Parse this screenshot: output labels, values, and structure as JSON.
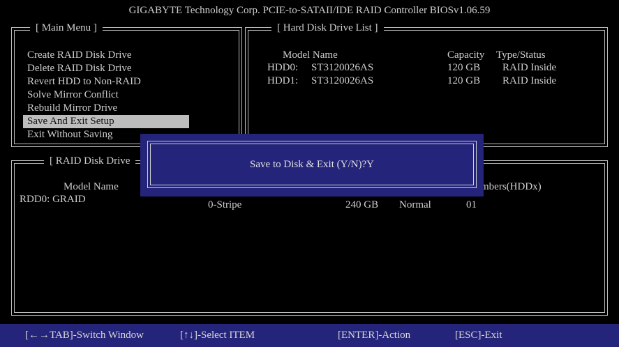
{
  "title": "GIGABYTE Technology Corp. PCIE-to-SATAII/IDE RAID Controller BIOSv1.06.59",
  "main_menu": {
    "title": "[ Main Menu ]",
    "items": [
      {
        "label": "Create RAID Disk Drive"
      },
      {
        "label": "Delete RAID Disk Drive"
      },
      {
        "label": "Revert HDD to Non-RAID"
      },
      {
        "label": "Solve Mirror Conflict"
      },
      {
        "label": "Rebuild Mirror Drive"
      },
      {
        "label": "Save And Exit Setup",
        "selected": true
      },
      {
        "label": "Exit Without Saving"
      }
    ]
  },
  "hdd_list": {
    "title": "[ Hard Disk Drive List ]",
    "headers": {
      "model": "Model Name",
      "capacity": "Capacity",
      "type": "Type/Status"
    },
    "rows": [
      {
        "id": "HDD0:",
        "model": "ST3120026AS",
        "capacity": "120 GB",
        "type": "RAID Inside"
      },
      {
        "id": "HDD1:",
        "model": "ST3120026AS",
        "capacity": "120 GB",
        "type": "RAID Inside"
      }
    ]
  },
  "raid_list": {
    "title": "[ RAID Disk Drive",
    "headers": {
      "model": "Model Name",
      "members": "mbers(HDDx)"
    },
    "rows": [
      {
        "model": "RDD0: GRAID",
        "level": "0-Stripe",
        "capacity": "240 GB",
        "status": "Normal",
        "members": "01"
      }
    ]
  },
  "dialog": {
    "text": "Save to Disk & Exit (Y/N)?Y"
  },
  "footer": {
    "switch": "[←→TAB]-Switch Window",
    "select": "[↑↓]-Select ITEM",
    "action": "[ENTER]-Action",
    "exit": "[ESC]-Exit"
  },
  "colors": {
    "dialog_bg": "#24247a",
    "highlight": "#bdbdbd",
    "text": "#cfcfcf"
  }
}
